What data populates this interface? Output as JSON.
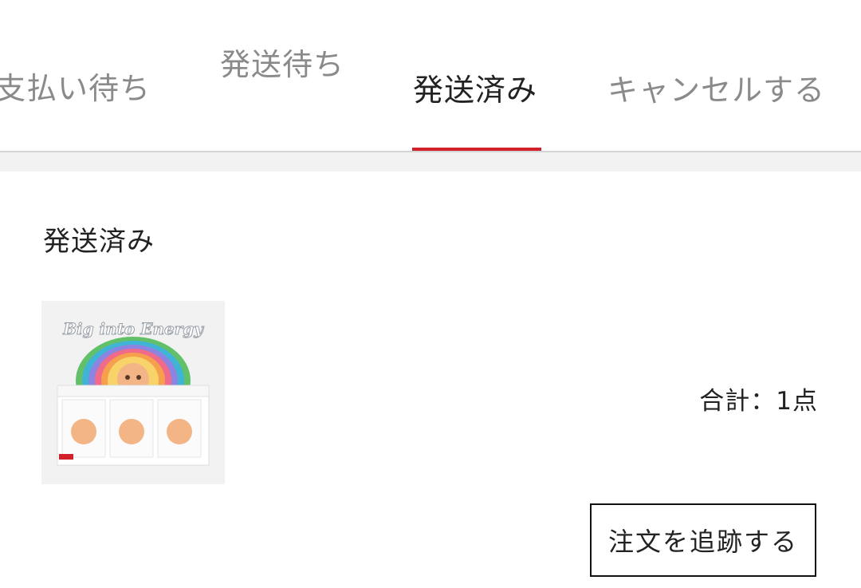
{
  "tabs": [
    {
      "label": "支払い待ち",
      "active": false
    },
    {
      "label": "発送待ち",
      "active": false
    },
    {
      "label": "発送済み",
      "active": true
    },
    {
      "label": "キャンセルする",
      "active": false
    }
  ],
  "colors": {
    "accent": "#d1202a",
    "text_primary": "#222222",
    "text_inactive": "#8a8a8a",
    "section_gap": "#f2f2f2"
  },
  "order": {
    "status": "発送済み",
    "product_image": {
      "icon": "product-box-image",
      "text": "Big into Energy"
    },
    "total": "合計：1点",
    "track_button_label": "注文を追跡する"
  }
}
